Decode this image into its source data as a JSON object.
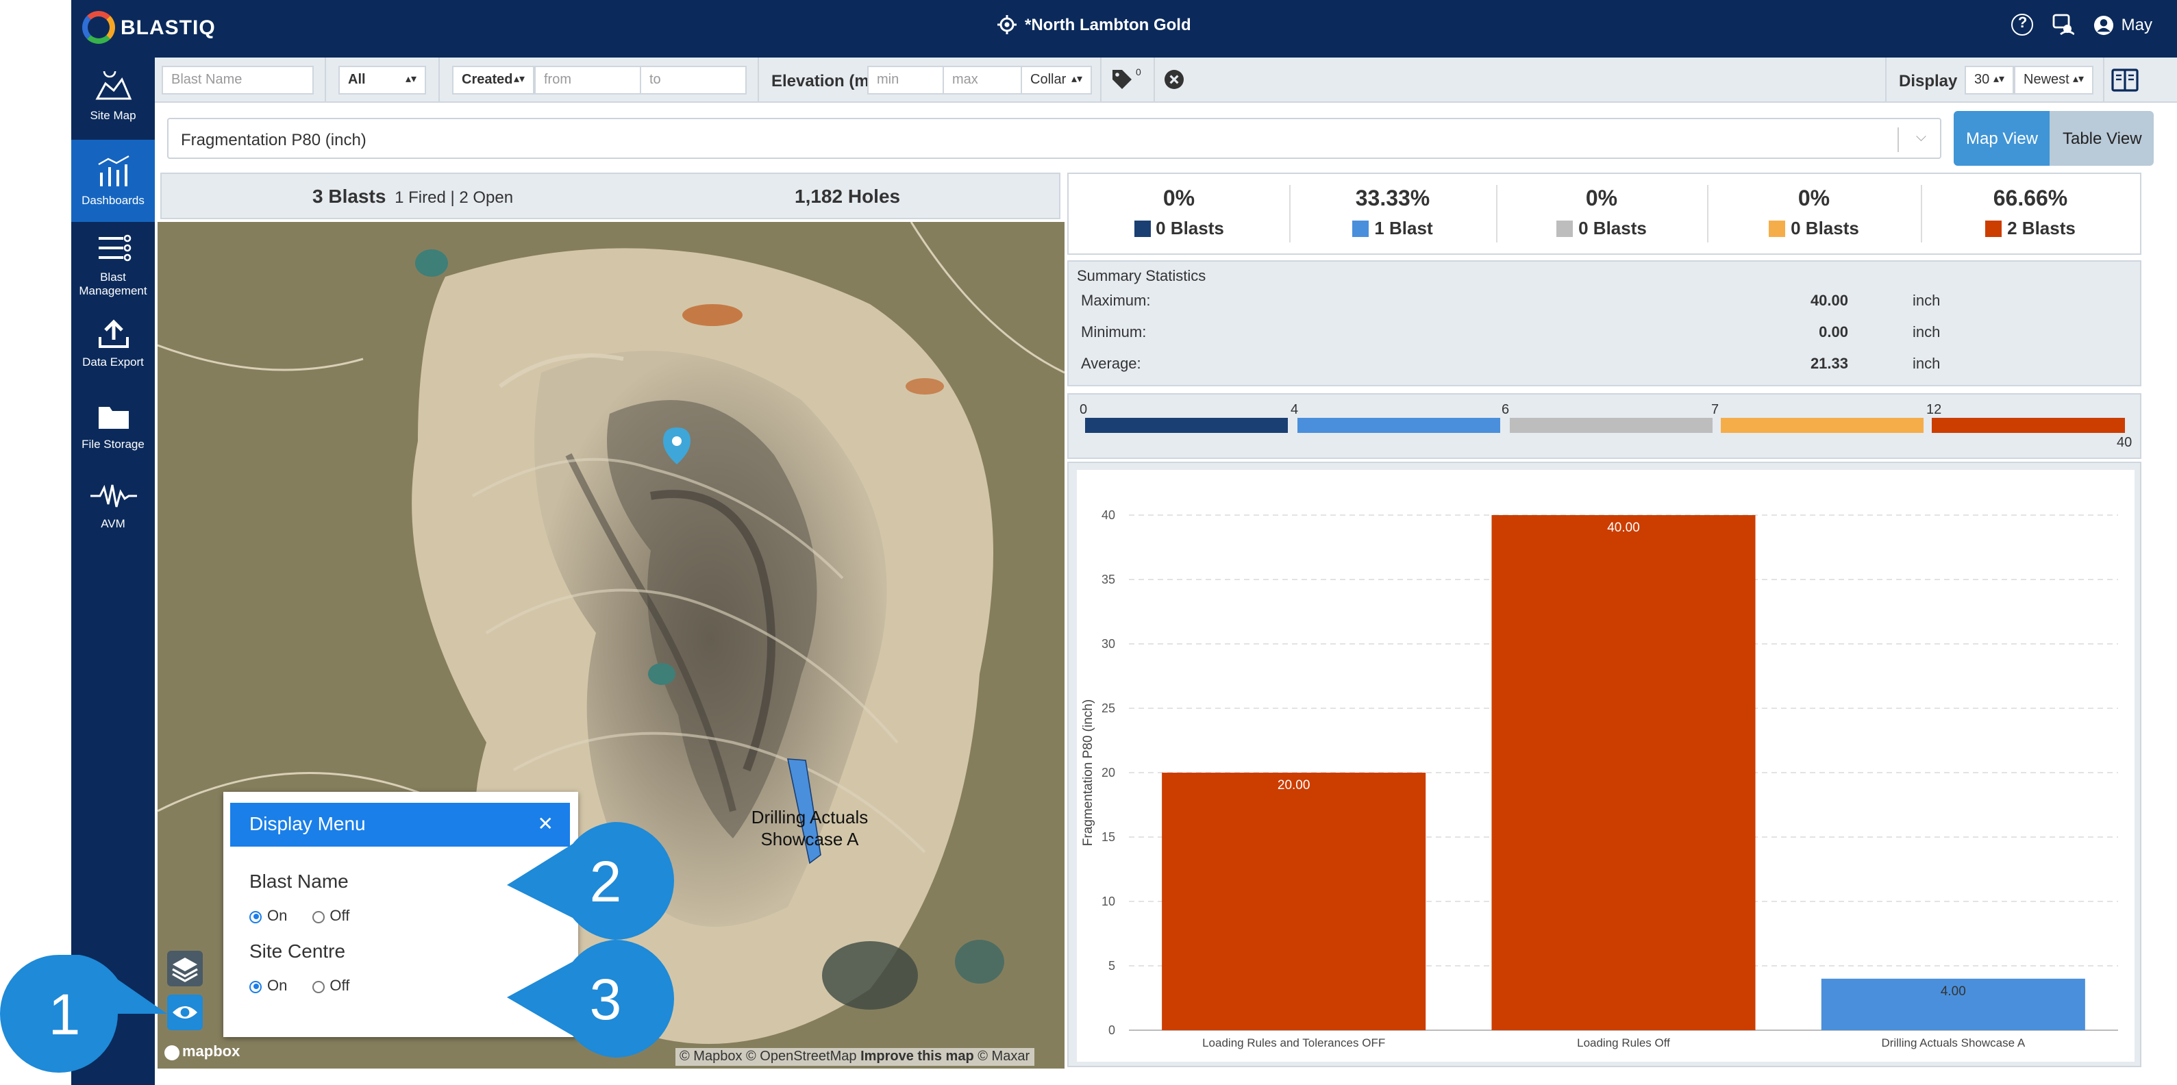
{
  "app": {
    "logo_text": "BLASTIQ",
    "site_name": "*North Lambton Gold",
    "user_name": "May"
  },
  "sidebar": {
    "items": [
      {
        "label": "Site Map",
        "icon": "site-map-icon"
      },
      {
        "label": "Dashboards",
        "icon": "dashboards-icon",
        "active": true
      },
      {
        "label": "Blast Management",
        "icon": "blast-management-icon"
      },
      {
        "label": "Data Export",
        "icon": "data-export-icon"
      },
      {
        "label": "File Storage",
        "icon": "folder-icon"
      },
      {
        "label": "AVM",
        "icon": "waveform-icon"
      }
    ]
  },
  "filters": {
    "blast_name_placeholder": "Blast Name",
    "status_value": "All",
    "date_field_value": "Created",
    "from_placeholder": "from",
    "to_placeholder": "to",
    "elevation_label": "Elevation (m)",
    "min_placeholder": "min",
    "max_placeholder": "max",
    "elevation_ref_value": "Collar",
    "tag_count": "0",
    "display_label": "Display",
    "display_count_value": "30",
    "sort_value": "Newest"
  },
  "measure": {
    "selected": "Fragmentation P80 (inch)"
  },
  "view_toggle": {
    "map_view": "Map View",
    "table_view": "Table View"
  },
  "blast_summary": {
    "blasts": "3 Blasts",
    "fired_open": "1 Fired | 2 Open",
    "holes": "1,182 Holes"
  },
  "map": {
    "blast_label_line1": "Drilling Actuals",
    "blast_label_line2": "Showcase A",
    "attribution": "© Mapbox © OpenStreetMap",
    "attribution_link": "Improve this map",
    "attribution_tail": "© Maxar",
    "mapbox_logo": "mapbox"
  },
  "display_menu": {
    "title": "Display Menu",
    "section1": "Blast Name",
    "section2": "Site Centre",
    "on": "On",
    "off": "Off",
    "blast_name_value": "On",
    "site_centre_value": "On"
  },
  "callouts": {
    "c1": "1",
    "c2": "2",
    "c3": "3"
  },
  "legend": [
    {
      "pct": "0%",
      "count": "0 Blasts",
      "color": "#1a3f73"
    },
    {
      "pct": "33.33%",
      "count": "1 Blast",
      "color": "#4a8fdb"
    },
    {
      "pct": "0%",
      "count": "0 Blasts",
      "color": "#bdbdbd"
    },
    {
      "pct": "0%",
      "count": "0 Blasts",
      "color": "#f5ad4a"
    },
    {
      "pct": "66.66%",
      "count": "2 Blasts",
      "color": "#cc3d00"
    }
  ],
  "stats": {
    "title": "Summary Statistics",
    "rows": [
      {
        "label": "Maximum:",
        "value": "40.00",
        "unit": "inch"
      },
      {
        "label": "Minimum:",
        "value": "0.00",
        "unit": "inch"
      },
      {
        "label": "Average:",
        "value": "21.33",
        "unit": "inch"
      }
    ]
  },
  "range_bar": {
    "ticks": [
      "0",
      "4",
      "6",
      "7",
      "12"
    ],
    "max": "40",
    "colors": [
      "#1a3f73",
      "#4a8fdb",
      "#bdbdbd",
      "#f5ad4a",
      "#cc3d00"
    ]
  },
  "chart_data": {
    "type": "bar",
    "categories": [
      "Loading Rules and Tolerances OFF",
      "Loading Rules Off",
      "Drilling Actuals Showcase A"
    ],
    "values": [
      20.0,
      40.0,
      4.0
    ],
    "data_labels": [
      "20.00",
      "40.00",
      "4.00"
    ],
    "colors": [
      "#cc3d00",
      "#cc3d00",
      "#4a8fdb"
    ],
    "ylabel": "Fragmentation P80 (inch)",
    "xlabel": "",
    "ylim": [
      0,
      40
    ],
    "yticks": [
      0,
      5,
      10,
      15,
      20,
      25,
      30,
      35,
      40
    ],
    "grid": true
  }
}
